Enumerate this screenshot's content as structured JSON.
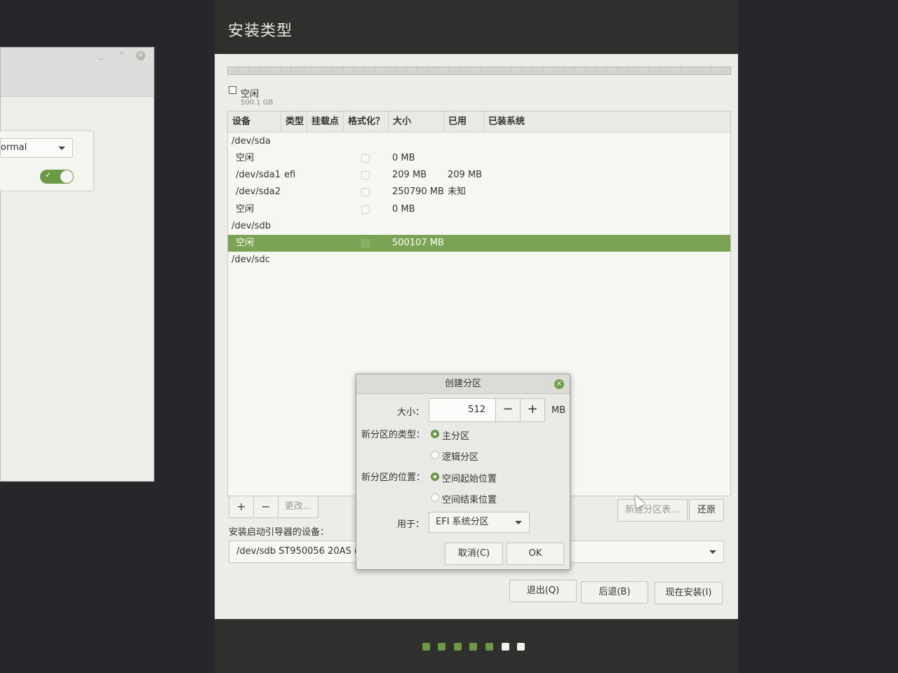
{
  "background_window": {
    "combo_value": "ormal",
    "switch_on": true
  },
  "installer": {
    "title": "安装类型",
    "free_legend": {
      "label": "空闲",
      "size": "500.1 GB"
    },
    "table": {
      "headers": [
        "设备",
        "类型",
        "挂载点",
        "格式化？",
        "大小",
        "已用",
        "已装系统"
      ],
      "rows": [
        {
          "device": "/dev/sda",
          "type": "",
          "mount": "",
          "format": false,
          "size": "",
          "used": "",
          "system": "",
          "is_disk": true,
          "selected": false
        },
        {
          "device": "空闲",
          "type": "",
          "mount": "",
          "format": false,
          "size": "0 MB",
          "used": "",
          "system": "",
          "is_disk": false,
          "selected": false
        },
        {
          "device": "/dev/sda1",
          "type": "efi",
          "mount": "",
          "format": false,
          "size": "209 MB",
          "used": "209 MB",
          "system": "",
          "is_disk": false,
          "selected": false
        },
        {
          "device": "/dev/sda2",
          "type": "",
          "mount": "",
          "format": false,
          "size": "250790 MB",
          "used": "未知",
          "system": "",
          "is_disk": false,
          "selected": false
        },
        {
          "device": "空闲",
          "type": "",
          "mount": "",
          "format": false,
          "size": "0 MB",
          "used": "",
          "system": "",
          "is_disk": false,
          "selected": false
        },
        {
          "device": "/dev/sdb",
          "type": "",
          "mount": "",
          "format": false,
          "size": "",
          "used": "",
          "system": "",
          "is_disk": true,
          "selected": false
        },
        {
          "device": "空闲",
          "type": "",
          "mount": "",
          "format": false,
          "size": "500107 MB",
          "used": "",
          "system": "",
          "is_disk": false,
          "selected": true
        },
        {
          "device": "/dev/sdc",
          "type": "",
          "mount": "",
          "format": false,
          "size": "",
          "used": "",
          "system": "",
          "is_disk": true,
          "selected": false
        }
      ]
    },
    "table_buttons": {
      "add": "+",
      "remove": "−",
      "change": "更改..."
    },
    "new_table_button": "新建分区表...",
    "revert_button": "还原",
    "bootloader_label": "安装启动引导器的设备：",
    "bootloader_value": "/dev/sdb   ST950056 20AS (",
    "buttons": {
      "quit": "退出(Q)",
      "back": "后退(B)",
      "install": "现在安装(I)"
    },
    "progress": {
      "completed_steps": 5,
      "total_steps": 7
    }
  },
  "dialog": {
    "title": "创建分区",
    "size_label": "大小：",
    "size_value": "512",
    "size_unit": "MB",
    "minus": "−",
    "plus": "+",
    "type_label": "新分区的类型：",
    "type_options": [
      "主分区",
      "逻辑分区"
    ],
    "type_selected": "主分区",
    "location_label": "新分区的位置：",
    "location_options": [
      "空间起始位置",
      "空间结束位置"
    ],
    "location_selected": "空间起始位置",
    "use_label": "用于：",
    "use_value": "EFI 系统分区",
    "cancel": "取消(C)",
    "ok": "OK"
  },
  "colors": {
    "accent": "#7aa454",
    "window_bg": "#ecece8",
    "titlebar": "#2f302d"
  }
}
